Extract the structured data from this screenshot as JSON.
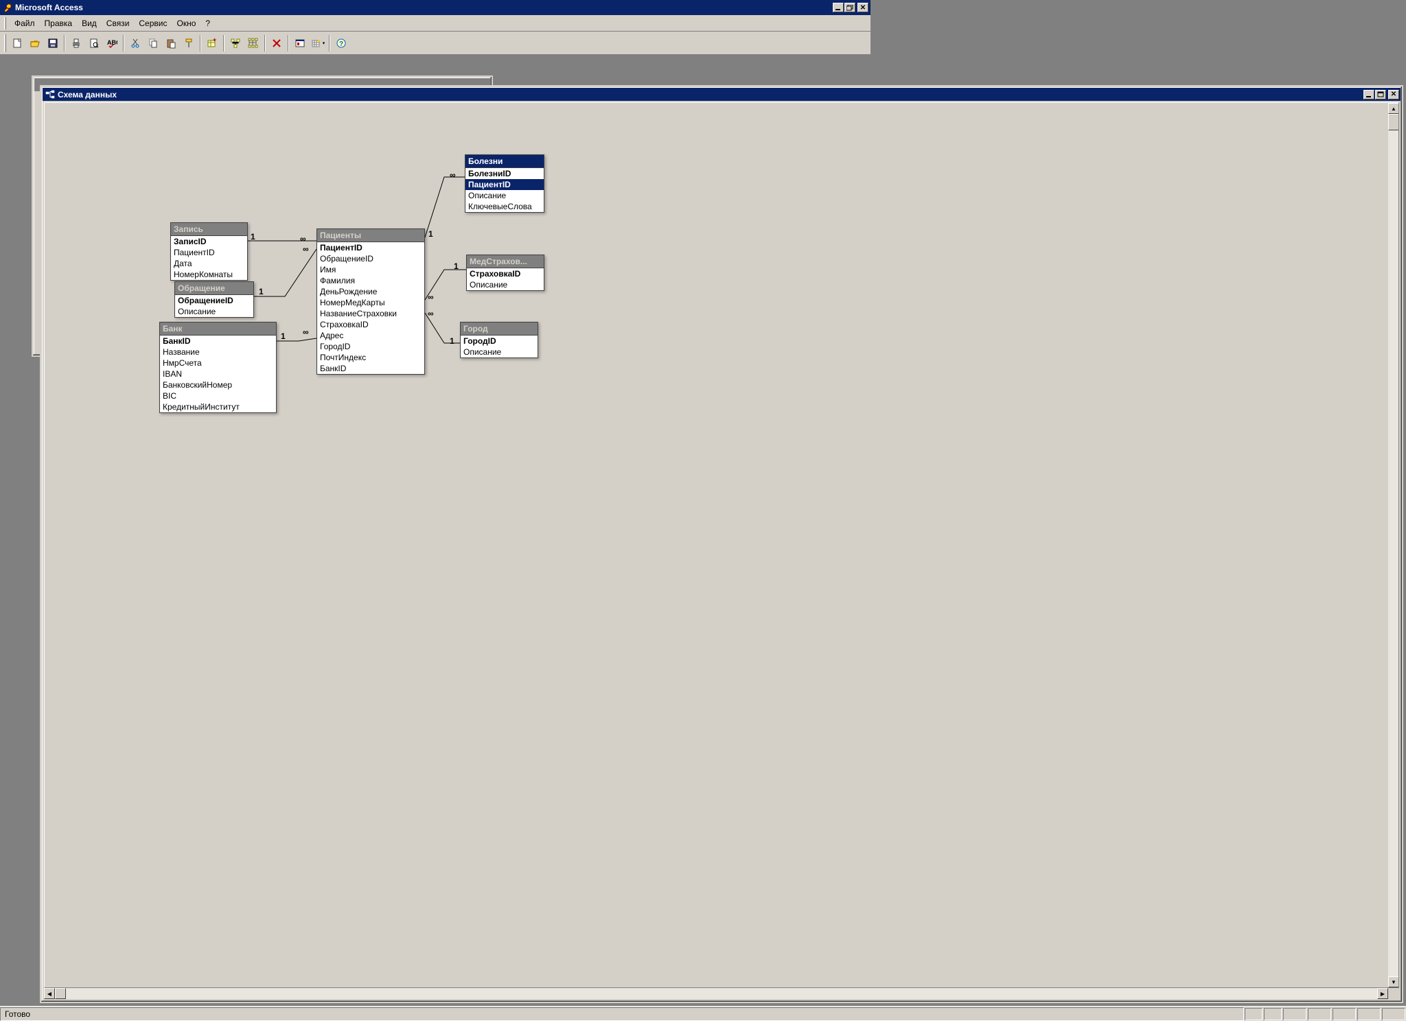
{
  "app": {
    "title": "Microsoft Access"
  },
  "menu": {
    "file": "Файл",
    "edit": "Правка",
    "view": "Вид",
    "relations": "Связи",
    "service": "Сервис",
    "window": "Окно",
    "help": "?"
  },
  "child_window": {
    "title": "Схема данных"
  },
  "statusbar": {
    "text": "Готово"
  },
  "card_one": "1",
  "card_many": "∞",
  "tables": {
    "zapis": {
      "title": "Запись",
      "fields": [
        "ЗаписID",
        "ПациентID",
        "Дата",
        "НомерКомнаты"
      ]
    },
    "obrashenie": {
      "title": "Обращение",
      "fields": [
        "ОбращениеID",
        "Описание"
      ]
    },
    "bank": {
      "title": "Банк",
      "fields": [
        "БанкID",
        "Название",
        "НмрСчета",
        "IBAN",
        "БанковскийНомер",
        "BIC",
        "КредитныйИнститут"
      ]
    },
    "patsienty": {
      "title": "Пациенты",
      "fields": [
        "ПациентID",
        "ОбращениеID",
        "Имя",
        "Фамилия",
        "ДеньРождение",
        "НомерМедКарты",
        "НазваниеСтраховки",
        "СтраховкаID",
        "Адрес",
        "ГородID",
        "ПочтИндекс",
        "БанкID"
      ]
    },
    "bolezni": {
      "title": "Болезни",
      "fields": [
        "БолезниID",
        "ПациентID",
        "Описание",
        "КлючевыеСлова"
      ]
    },
    "medstrah": {
      "title": "МедСтрахов...",
      "fields": [
        "СтраховкаID",
        "Описание"
      ]
    },
    "gorod": {
      "title": "Город",
      "fields": [
        "ГородID",
        "Описание"
      ]
    }
  }
}
